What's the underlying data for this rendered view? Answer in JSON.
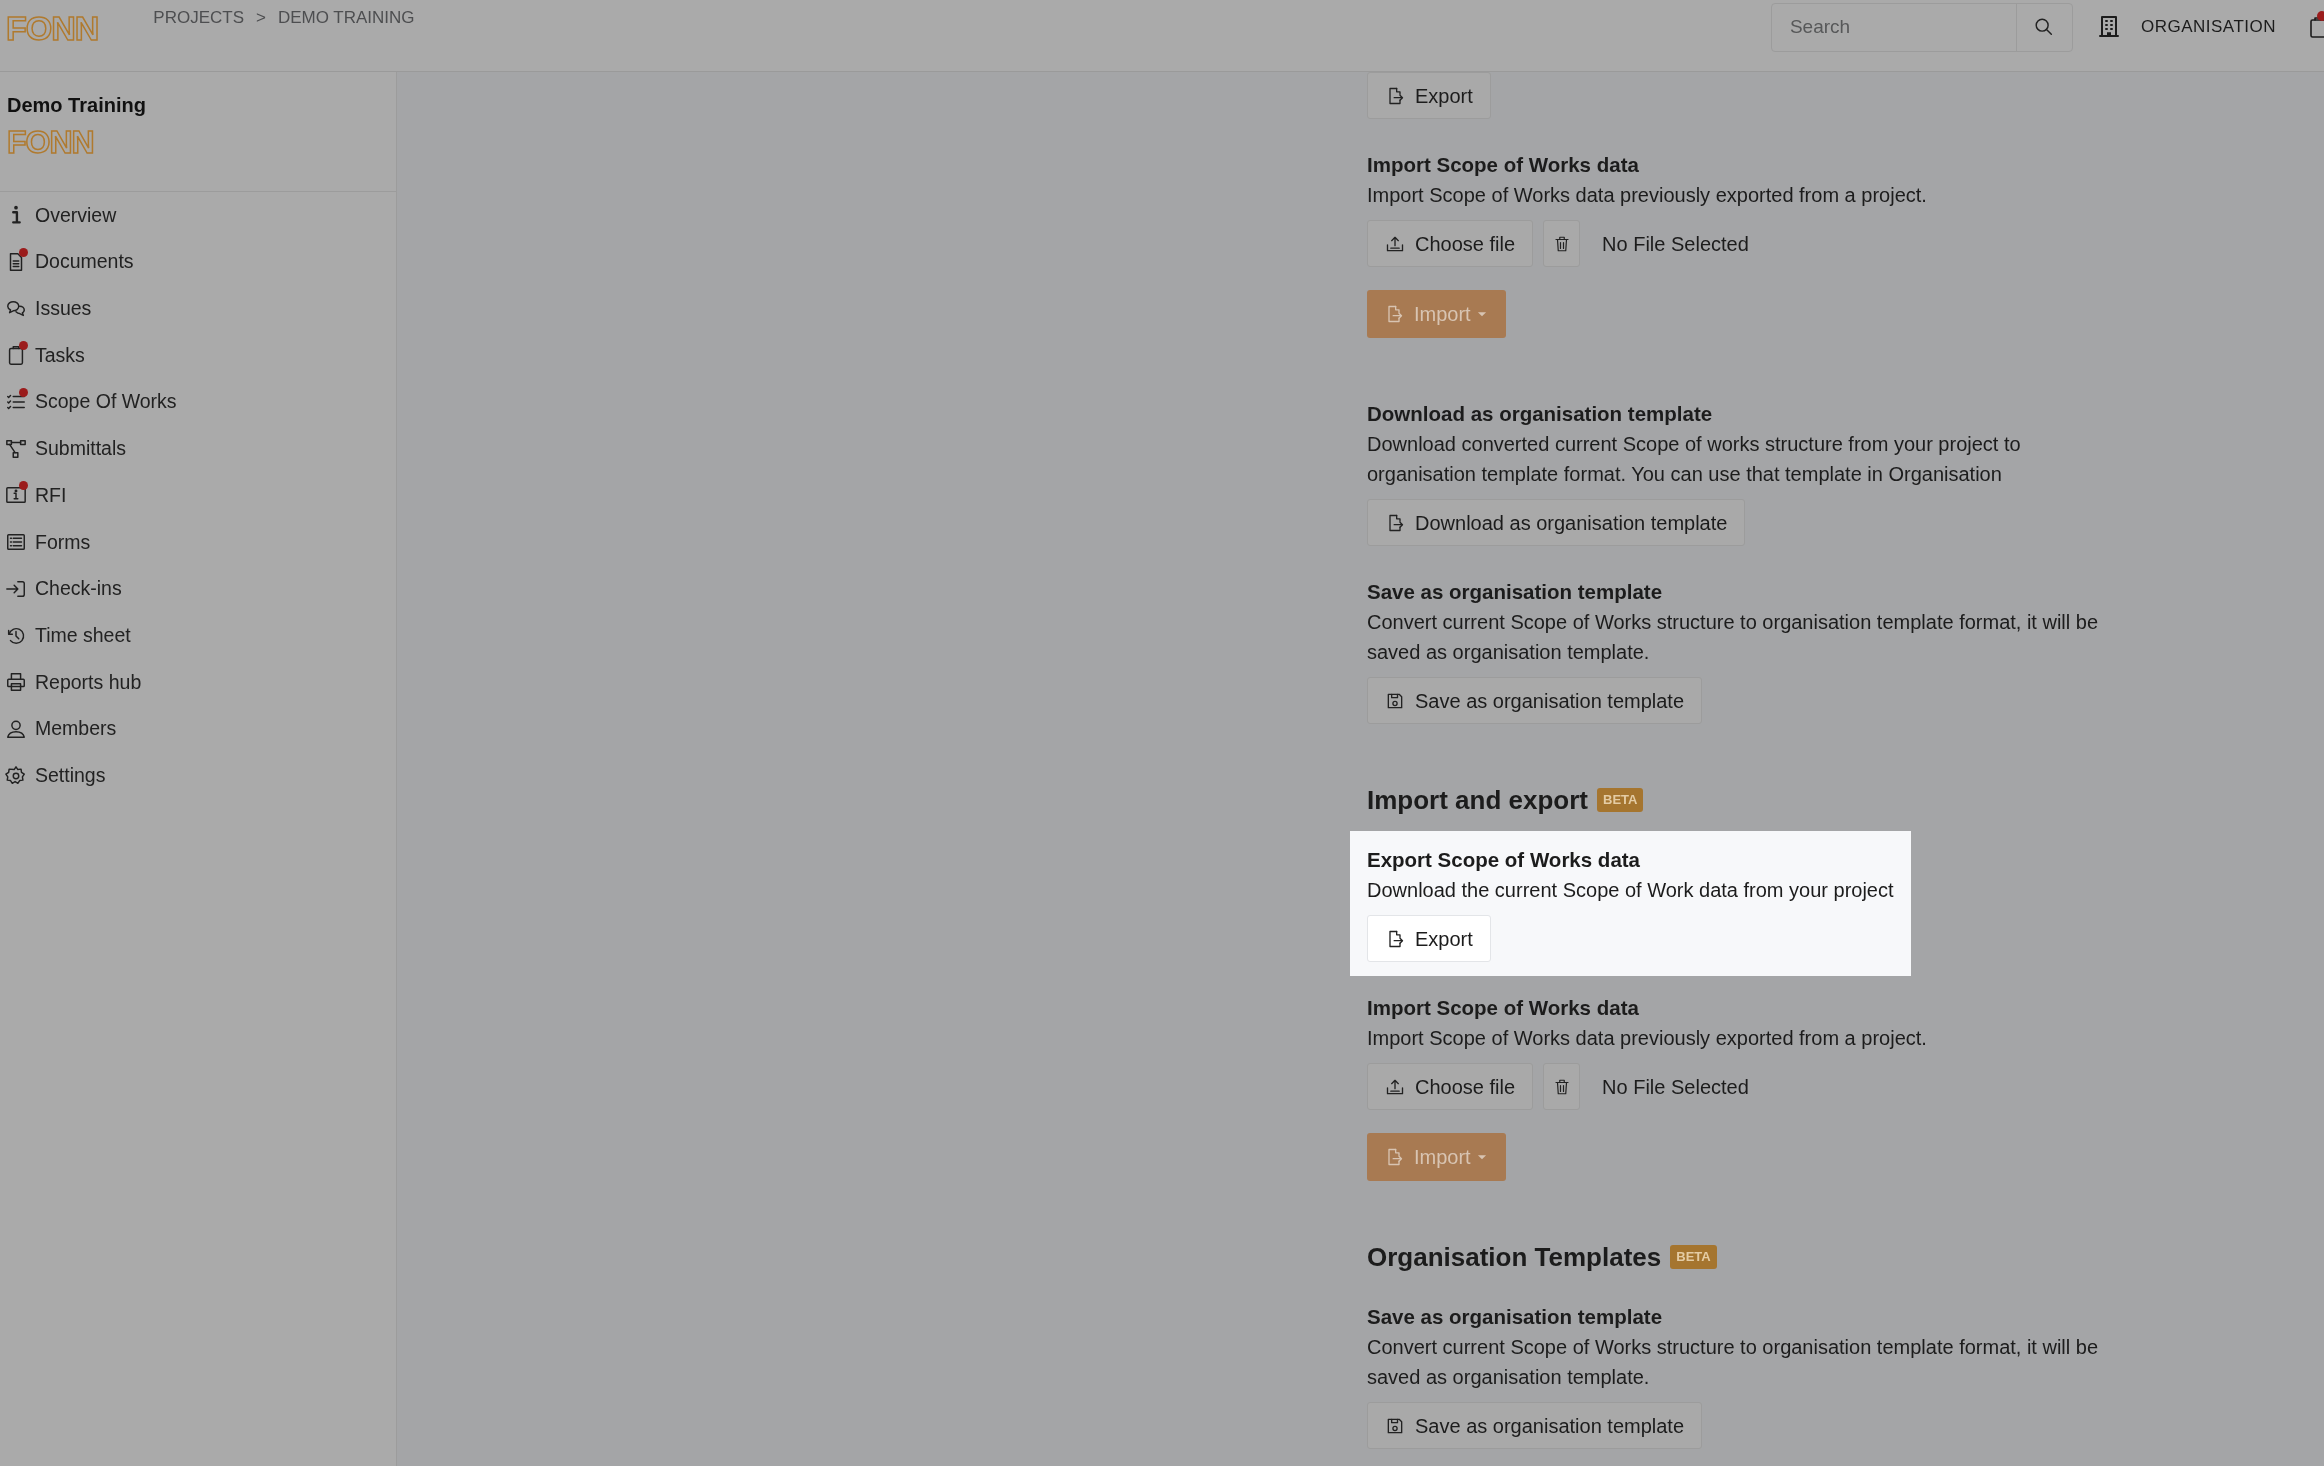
{
  "header": {
    "logo": "FONN",
    "breadcrumb": [
      "PROJECTS",
      ">",
      "DEMO TRAINING"
    ],
    "search": {
      "placeholder": "Search"
    },
    "organisation": "ORGANISATION",
    "clipboard_badge": true
  },
  "sidebar": {
    "project_title": "Demo Training",
    "logo": "FONN",
    "items": [
      {
        "label": "Overview",
        "badge": false
      },
      {
        "label": "Documents",
        "badge": true
      },
      {
        "label": "Issues",
        "badge": false
      },
      {
        "label": "Tasks",
        "badge": true
      },
      {
        "label": "Scope Of Works",
        "badge": true
      },
      {
        "label": "Submittals",
        "badge": false
      },
      {
        "label": "RFI",
        "badge": true
      },
      {
        "label": "Forms",
        "badge": false
      },
      {
        "label": "Check-ins",
        "badge": false
      },
      {
        "label": "Time sheet",
        "badge": false
      },
      {
        "label": "Reports hub",
        "badge": false
      },
      {
        "label": "Members",
        "badge": false
      },
      {
        "label": "Settings",
        "badge": false
      }
    ]
  },
  "content": [
    {
      "kind": "export",
      "highlighted": false,
      "button": "Export"
    },
    {
      "kind": "import",
      "highlighted": false,
      "title": "Import Scope of Works data",
      "description": "Import Scope of Works data previously exported from a project.",
      "choose_button": "Choose file",
      "file_status": "No File Selected",
      "import_button": "Import"
    },
    {
      "kind": "export",
      "highlighted": false,
      "title": "Download as organisation template",
      "description": "Download converted current Scope of works structure from your project to organisation template format. You can use that template in Organisation",
      "button": "Download as organisation template"
    },
    {
      "kind": "save",
      "highlighted": false,
      "title": "Save as organisation template",
      "description": "Convert current Scope of Works structure to organisation template format, it will be saved as organisation template.",
      "button": "Save as organisation template"
    },
    {
      "kind": "heading",
      "text": "Import and export",
      "badge": "BETA"
    },
    {
      "kind": "export",
      "highlighted": true,
      "title": "Export Scope of Works data",
      "description": "Download the current Scope of Work data from your project",
      "button": "Export"
    },
    {
      "kind": "import",
      "highlighted": false,
      "title": "Import Scope of Works data",
      "description": "Import Scope of Works data previously exported from a project.",
      "choose_button": "Choose file",
      "file_status": "No File Selected",
      "import_button": "Import"
    },
    {
      "kind": "heading",
      "text": "Organisation Templates",
      "badge": "BETA"
    },
    {
      "kind": "save",
      "highlighted": false,
      "title": "Save as organisation template",
      "description": "Convert current Scope of Works structure to organisation template format, it will be saved as organisation template.",
      "button": "Save as organisation template"
    }
  ]
}
